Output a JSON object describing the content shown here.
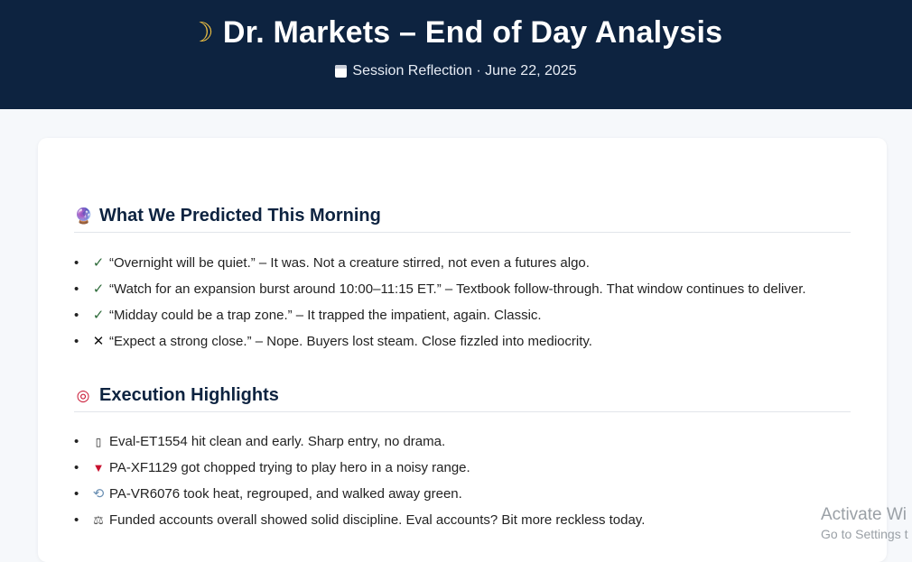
{
  "header": {
    "title_icon": "crescent-moon-icon",
    "title": "Dr. Markets – End of Day Analysis",
    "subtitle_icon": "calendar-icon",
    "subtitle": "Session Reflection · June 22, 2025"
  },
  "predictions": {
    "icon": "crystal-ball-icon",
    "title": "What We Predicted This Morning",
    "items": [
      {
        "icon": "check-icon",
        "glyph": "✓",
        "text": "“Overnight will be quiet.” – It was. Not a creature stirred, not even a futures algo."
      },
      {
        "icon": "check-icon",
        "glyph": "✓",
        "text": "“Watch for an expansion burst around 10:00–11:15 ET.” – Textbook follow-through. That window continues to deliver."
      },
      {
        "icon": "check-icon",
        "glyph": "✓",
        "text": "“Midday could be a trap zone.” – It trapped the impatient, again. Classic."
      },
      {
        "icon": "cross-icon",
        "glyph": "✕",
        "text": "“Expect a strong close.” – Nope. Buyers lost steam. Close fizzled into mediocrity."
      }
    ]
  },
  "execution": {
    "icon": "target-icon",
    "title": "Execution Highlights",
    "items": [
      {
        "icon": "box-icon",
        "glyph": "▯",
        "text": "Eval-ET1554 hit clean and early. Sharp entry, no drama."
      },
      {
        "icon": "down-triangle-icon",
        "glyph": "▼",
        "text": "PA-XF1129 got chopped trying to play hero in a noisy range."
      },
      {
        "icon": "cycle-arrows-icon",
        "glyph": "⟲",
        "text": "PA-VR6076 took heat, regrouped, and walked away green."
      },
      {
        "icon": "scale-icon",
        "glyph": "⚖",
        "text": "Funded accounts overall showed solid discipline. Eval accounts? Bit more reckless today."
      }
    ]
  },
  "watermark": {
    "line1": "Activate Wi",
    "line2": "Go to Settings t"
  }
}
